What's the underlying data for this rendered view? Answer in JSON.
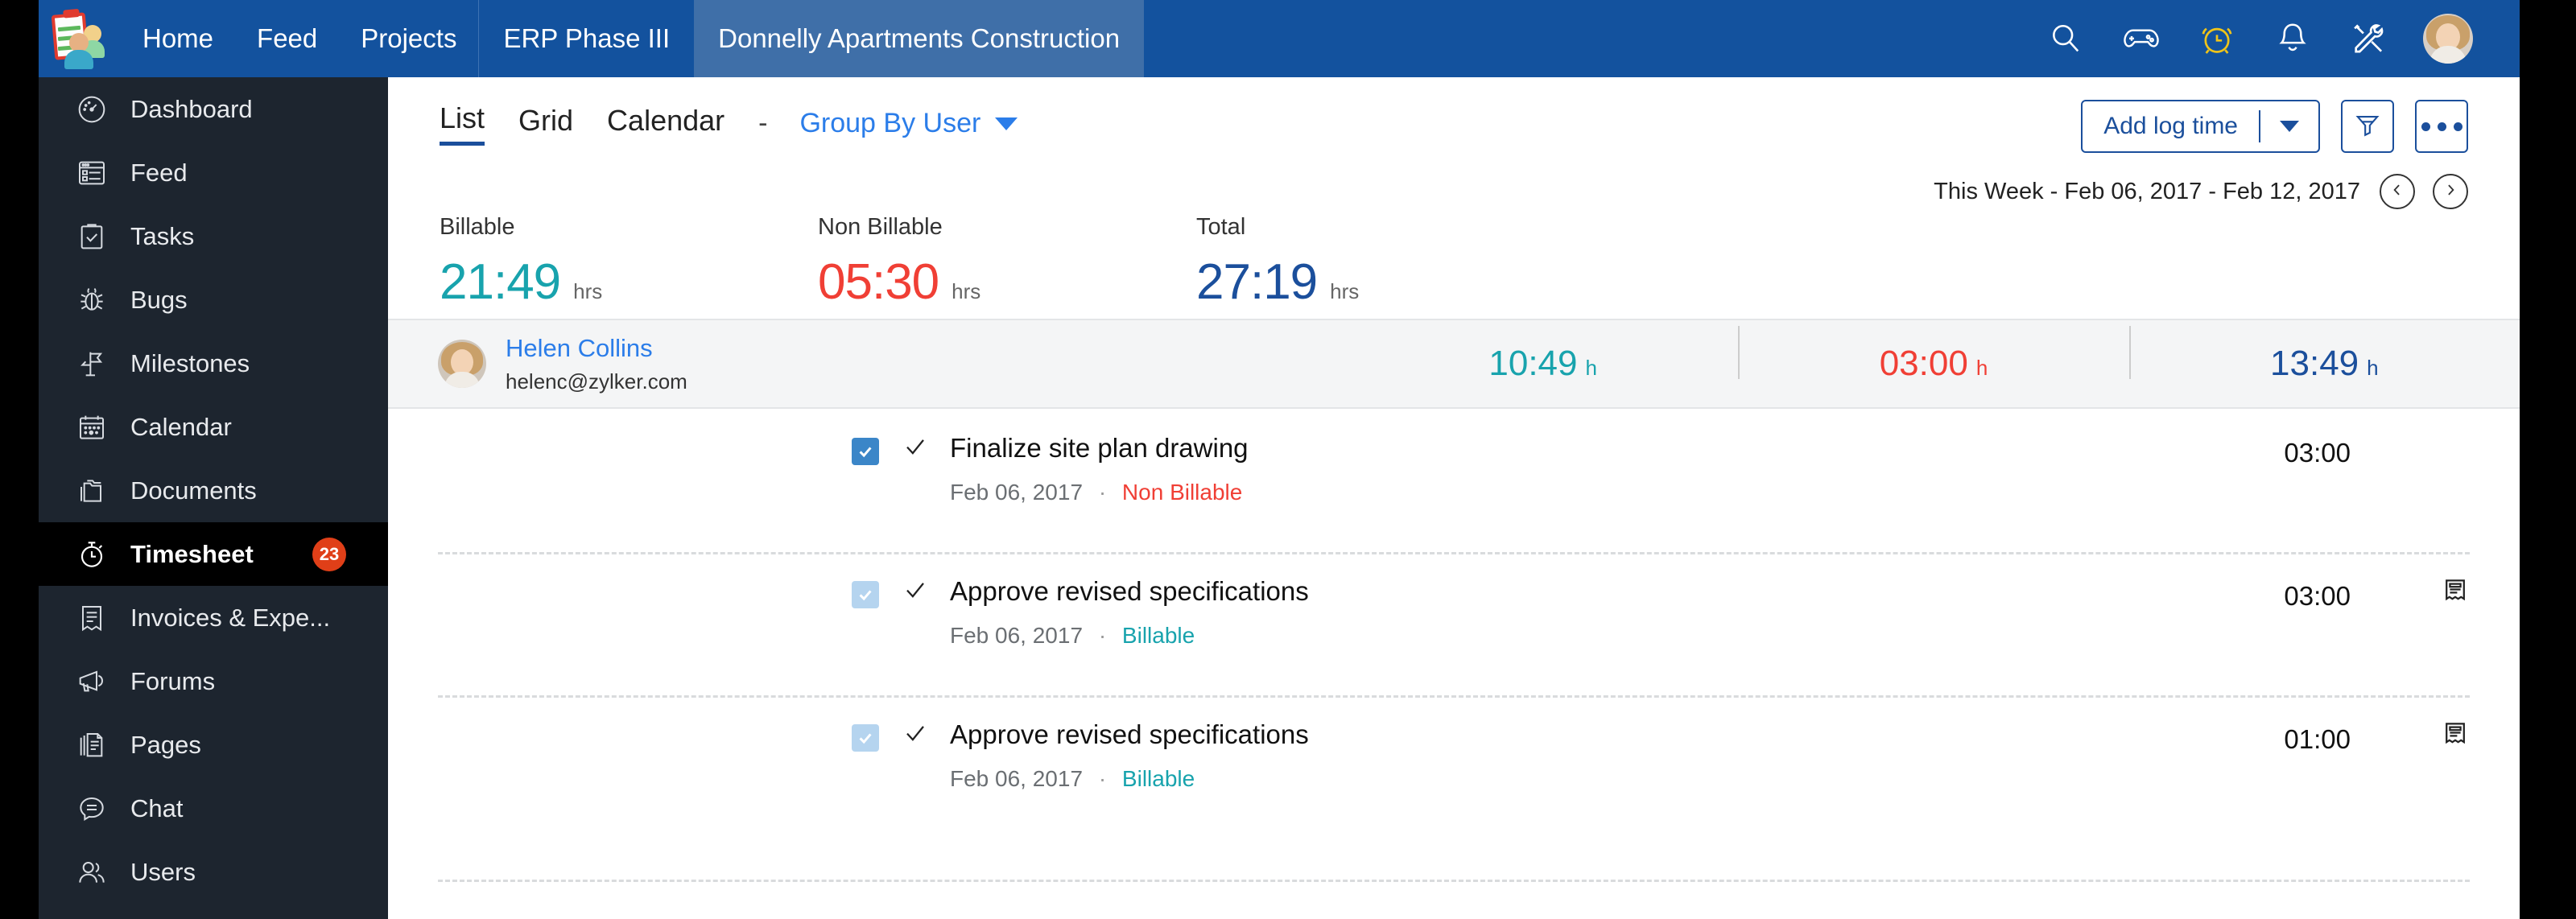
{
  "colors": {
    "header_bg": "#13529e",
    "header_tab_active": "#3f6fa8",
    "sidebar_bg": "#1d252f",
    "sidebar_active_bg": "#000000",
    "badge": "#e03f18",
    "billable": "#18a3ad",
    "non_billable": "#f03f35",
    "total": "#1b4f9c",
    "link": "#2b7de9",
    "accent": "#1b4f9c"
  },
  "header": {
    "logo_name": "zoho-projects-logo",
    "nav": [
      {
        "label": "Home",
        "name": "nav-home"
      },
      {
        "label": "Feed",
        "name": "nav-feed"
      },
      {
        "label": "Projects",
        "name": "nav-projects"
      }
    ],
    "tabs": [
      {
        "label": "ERP Phase III",
        "active": false
      },
      {
        "label": "Donnelly Apartments Construction",
        "active": true
      }
    ],
    "icons": [
      "search-icon",
      "gamepad-icon",
      "alarm-clock-icon",
      "bell-icon",
      "tools-icon"
    ],
    "avatar": "user-avatar"
  },
  "sidebar": {
    "items": [
      {
        "label": "Dashboard",
        "icon": "speedometer-icon",
        "active": false,
        "badge": null
      },
      {
        "label": "Feed",
        "icon": "feed-icon",
        "active": false,
        "badge": null
      },
      {
        "label": "Tasks",
        "icon": "clipboard-check-icon",
        "active": false,
        "badge": null
      },
      {
        "label": "Bugs",
        "icon": "bug-icon",
        "active": false,
        "badge": null
      },
      {
        "label": "Milestones",
        "icon": "flag-icon",
        "active": false,
        "badge": null
      },
      {
        "label": "Calendar",
        "icon": "calendar-icon",
        "active": false,
        "badge": null
      },
      {
        "label": "Documents",
        "icon": "folder-icon",
        "active": false,
        "badge": null
      },
      {
        "label": "Timesheet",
        "icon": "stopwatch-icon",
        "active": true,
        "badge": "23"
      },
      {
        "label": "Invoices & Expe...",
        "icon": "invoice-icon",
        "active": false,
        "badge": null
      },
      {
        "label": "Forums",
        "icon": "megaphone-icon",
        "active": false,
        "badge": null
      },
      {
        "label": "Pages",
        "icon": "pages-icon",
        "active": false,
        "badge": null
      },
      {
        "label": "Chat",
        "icon": "chat-icon",
        "active": false,
        "badge": null
      },
      {
        "label": "Users",
        "icon": "users-icon",
        "active": false,
        "badge": null
      }
    ]
  },
  "toolbar": {
    "view_tabs": [
      {
        "label": "List",
        "active": true
      },
      {
        "label": "Grid",
        "active": false
      },
      {
        "label": "Calendar",
        "active": false
      }
    ],
    "separator": "-",
    "group_by_label": "Group By User",
    "add_log_time_label": "Add log time",
    "filter_icon": "filter-icon",
    "more_icon": "more-options-icon"
  },
  "daterange": {
    "text": "This Week -  Feb 06, 2017 - Feb 12, 2017",
    "prev_icon": "chevron-left-icon",
    "next_icon": "chevron-right-icon"
  },
  "stats": [
    {
      "label": "Billable",
      "value": "21:49",
      "unit": "hrs",
      "color": "#18a3ad"
    },
    {
      "label": "Non Billable",
      "value": "05:30",
      "unit": "hrs",
      "color": "#f03f35"
    },
    {
      "label": "Total",
      "value": "27:19",
      "unit": "hrs",
      "color": "#1b4f9c"
    }
  ],
  "user_group": {
    "name": "Helen Collins",
    "email": "helenc@zylker.com",
    "avatar": "helen-collins-avatar",
    "totals": [
      {
        "value": "10:49",
        "unit": "h",
        "color": "#18a3ad"
      },
      {
        "value": "03:00",
        "unit": "h",
        "color": "#f03f35"
      },
      {
        "value": "13:49",
        "unit": "h",
        "color": "#1b4f9c"
      }
    ]
  },
  "tasks": [
    {
      "title": "Finalize site plan drawing",
      "date": "Feb 06, 2017",
      "dot": "·",
      "billing": "Non Billable",
      "billing_type": "nonbill",
      "hours": "03:00",
      "checked": true,
      "checkbox_state": "checked",
      "has_invoice_icon": false
    },
    {
      "title": "Approve revised specifications",
      "date": "Feb 06, 2017",
      "dot": "·",
      "billing": "Billable",
      "billing_type": "bill",
      "hours": "03:00",
      "checked": true,
      "checkbox_state": "disabled-checked",
      "has_invoice_icon": true
    },
    {
      "title": "Approve revised specifications",
      "date": "Feb 06, 2017",
      "dot": "·",
      "billing": "Billable",
      "billing_type": "bill",
      "hours": "01:00",
      "checked": true,
      "checkbox_state": "disabled-checked",
      "has_invoice_icon": true
    }
  ]
}
